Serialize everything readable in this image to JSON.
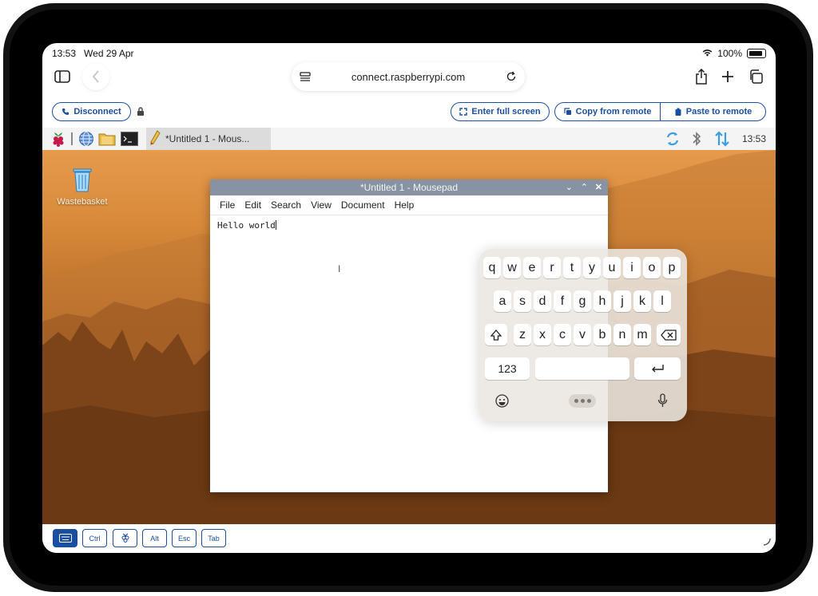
{
  "status_bar": {
    "time": "13:53",
    "date": "Wed 29 Apr",
    "battery": "100%"
  },
  "browser": {
    "url": "connect.raspberrypi.com"
  },
  "connect_toolbar": {
    "disconnect": "Disconnect",
    "fullscreen": "Enter full screen",
    "copy_from_remote": "Copy from remote",
    "paste_to_remote": "Paste to remote"
  },
  "taskbar": {
    "window_button": "*Untitled 1 - Mous...",
    "clock": "13:53"
  },
  "desktop": {
    "wastebasket_label": "Wastebasket"
  },
  "mousepad": {
    "title": "*Untitled 1 - Mousepad",
    "menu": [
      "File",
      "Edit",
      "Search",
      "View",
      "Document",
      "Help"
    ],
    "content": "Hello world"
  },
  "keyboard": {
    "row1": [
      "q",
      "w",
      "e",
      "r",
      "t",
      "y",
      "u",
      "i",
      "o",
      "p"
    ],
    "row2": [
      "a",
      "s",
      "d",
      "f",
      "g",
      "h",
      "j",
      "k",
      "l"
    ],
    "row3": [
      "z",
      "x",
      "c",
      "v",
      "b",
      "n",
      "m"
    ],
    "numbers_key": "123"
  },
  "modifier_bar": {
    "ctrl": "Ctrl",
    "alt": "Alt",
    "esc": "Esc",
    "tab": "Tab"
  },
  "colors": {
    "accent": "#1a4e9f",
    "titlebar": "#8793a3"
  }
}
